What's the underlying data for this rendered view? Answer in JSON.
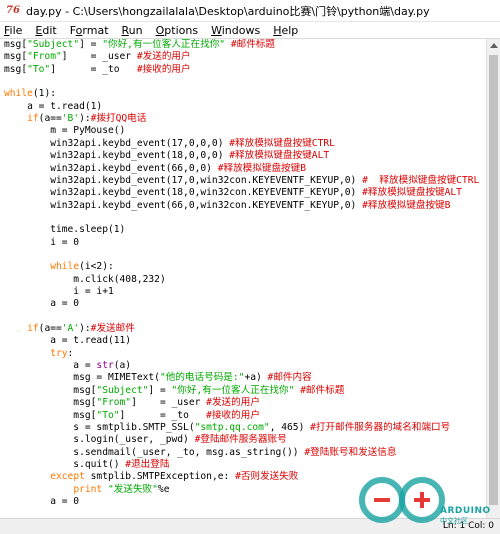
{
  "window": {
    "title": "day.py - C:\\Users\\hongzailalala\\Desktop\\arduino比赛\\门铃\\python端\\day.py",
    "app_icon": "76"
  },
  "menu": [
    {
      "label": "File",
      "accel": "F",
      "rest": "ile"
    },
    {
      "label": "Edit",
      "accel": "E",
      "rest": "dit"
    },
    {
      "label": "Format",
      "accel": "o",
      "pre": "F",
      "rest": "rmat"
    },
    {
      "label": "Run",
      "accel": "R",
      "rest": "un"
    },
    {
      "label": "Options",
      "accel": "O",
      "rest": "ptions"
    },
    {
      "label": "Windows",
      "accel": "W",
      "rest": "indows"
    },
    {
      "label": "Help",
      "accel": "H",
      "rest": "elp"
    }
  ],
  "code_lines": [
    [
      [
        "msg[",
        "n"
      ],
      [
        "\"Subject\"",
        "s"
      ],
      [
        "] = ",
        "n"
      ],
      [
        "\"你好,有一位客人正在找你\"",
        "s"
      ],
      [
        " #邮件标题",
        "c"
      ]
    ],
    [
      [
        "msg[",
        "n"
      ],
      [
        "\"From\"",
        "s"
      ],
      [
        "]    = _user ",
        "n"
      ],
      [
        "#发送的用户",
        "c"
      ]
    ],
    [
      [
        "msg[",
        "n"
      ],
      [
        "\"To\"",
        "s"
      ],
      [
        "]      = _to   ",
        "n"
      ],
      [
        "#接收的用户",
        "c"
      ]
    ],
    [],
    [
      [
        "while",
        "k"
      ],
      [
        "(1):",
        "n"
      ]
    ],
    [
      [
        "    a = t.read(1)",
        "n"
      ]
    ],
    [
      [
        "    ",
        "n"
      ],
      [
        "if",
        "k"
      ],
      [
        "(a==",
        "n"
      ],
      [
        "'B'",
        "s"
      ],
      [
        "):",
        "n"
      ],
      [
        "#拨打QQ电话",
        "c"
      ]
    ],
    [
      [
        "        m = PyMouse()",
        "n"
      ]
    ],
    [
      [
        "        win32api.keybd_event(17,0,0,0) ",
        "n"
      ],
      [
        "#释放模拟键盘按键CTRL",
        "c"
      ]
    ],
    [
      [
        "        win32api.keybd_event(18,0,0,0) ",
        "n"
      ],
      [
        "#释放模拟键盘按键ALT",
        "c"
      ]
    ],
    [
      [
        "        win32api.keybd_event(66,0,0) ",
        "n"
      ],
      [
        "#释放模拟键盘按键B",
        "c"
      ]
    ],
    [
      [
        "        win32api.keybd_event(17,0,win32con.KEYEVENTF_KEYUP,0) ",
        "n"
      ],
      [
        "#  释放模拟键盘按键CTRL",
        "c"
      ]
    ],
    [
      [
        "        win32api.keybd_event(18,0,win32con.KEYEVENTF_KEYUP,0) ",
        "n"
      ],
      [
        "#释放模拟键盘按键ALT",
        "c"
      ]
    ],
    [
      [
        "        win32api.keybd_event(66,0,win32con.KEYEVENTF_KEYUP,0) ",
        "n"
      ],
      [
        "#释放模拟键盘按键B",
        "c"
      ]
    ],
    [],
    [
      [
        "        time.sleep(1)",
        "n"
      ]
    ],
    [
      [
        "        i = 0",
        "n"
      ]
    ],
    [],
    [
      [
        "        ",
        "n"
      ],
      [
        "while",
        "k"
      ],
      [
        "(i<2):",
        "n"
      ]
    ],
    [
      [
        "            m.click(408,232)",
        "n"
      ]
    ],
    [
      [
        "            i = i+1",
        "n"
      ]
    ],
    [
      [
        "        a = 0",
        "n"
      ]
    ],
    [],
    [
      [
        "    ",
        "n"
      ],
      [
        "if",
        "k"
      ],
      [
        "(a==",
        "n"
      ],
      [
        "'A'",
        "s"
      ],
      [
        "):",
        "n"
      ],
      [
        "#发送邮件",
        "c"
      ]
    ],
    [
      [
        "        a = t.read(11)",
        "n"
      ]
    ],
    [
      [
        "        ",
        "n"
      ],
      [
        "try",
        "k"
      ],
      [
        ":",
        "n"
      ]
    ],
    [
      [
        "            a = ",
        "n"
      ],
      [
        "str",
        "b"
      ],
      [
        "(a)",
        "n"
      ]
    ],
    [
      [
        "            msg = MIMEText(",
        "n"
      ],
      [
        "\"他的电话号码是:\"",
        "s"
      ],
      [
        "+a) ",
        "n"
      ],
      [
        "#邮件内容",
        "c"
      ]
    ],
    [
      [
        "            msg[",
        "n"
      ],
      [
        "\"Subject\"",
        "s"
      ],
      [
        "] = ",
        "n"
      ],
      [
        "\"你好,有一位客人正在找你\"",
        "s"
      ],
      [
        " #邮件标题",
        "c"
      ]
    ],
    [
      [
        "            msg[",
        "n"
      ],
      [
        "\"From\"",
        "s"
      ],
      [
        "]    = _user ",
        "n"
      ],
      [
        "#发送的用户",
        "c"
      ]
    ],
    [
      [
        "            msg[",
        "n"
      ],
      [
        "\"To\"",
        "s"
      ],
      [
        "]      = _to   ",
        "n"
      ],
      [
        "#接收的用户",
        "c"
      ]
    ],
    [
      [
        "            s = smtplib.SMTP_SSL(",
        "n"
      ],
      [
        "\"smtp.qq.com\"",
        "s"
      ],
      [
        ", 465) ",
        "n"
      ],
      [
        "#打开邮件服务器的域名和端口号",
        "c"
      ]
    ],
    [
      [
        "            s.login(_user, _pwd) ",
        "n"
      ],
      [
        "#登陆邮件服务器账号",
        "c"
      ]
    ],
    [
      [
        "            s.sendmail(_user, _to, msg.as_string()) ",
        "n"
      ],
      [
        "#登陆账号和发送信息",
        "c"
      ]
    ],
    [
      [
        "            s.quit() ",
        "n"
      ],
      [
        "#退出登陆",
        "c"
      ]
    ],
    [
      [
        "        ",
        "n"
      ],
      [
        "except",
        "k"
      ],
      [
        " smtplib.SMTPException,e: ",
        "n"
      ],
      [
        "#否则发送失败",
        "c"
      ]
    ],
    [
      [
        "            ",
        "n"
      ],
      [
        "print",
        "k"
      ],
      [
        " ",
        "n"
      ],
      [
        "\"发送失败\"",
        "s"
      ],
      [
        "%e",
        "n"
      ]
    ],
    [
      [
        "        a = 0",
        "n"
      ]
    ]
  ],
  "status": {
    "position": "Ln: 1  Col: 0"
  },
  "watermark": {
    "brand": "ARDUINO",
    "sub": "中文社区"
  },
  "colors": {
    "keyword": "#ff7700",
    "string": "#00aa00",
    "comment": "#dd0000",
    "builtin": "#900090"
  }
}
